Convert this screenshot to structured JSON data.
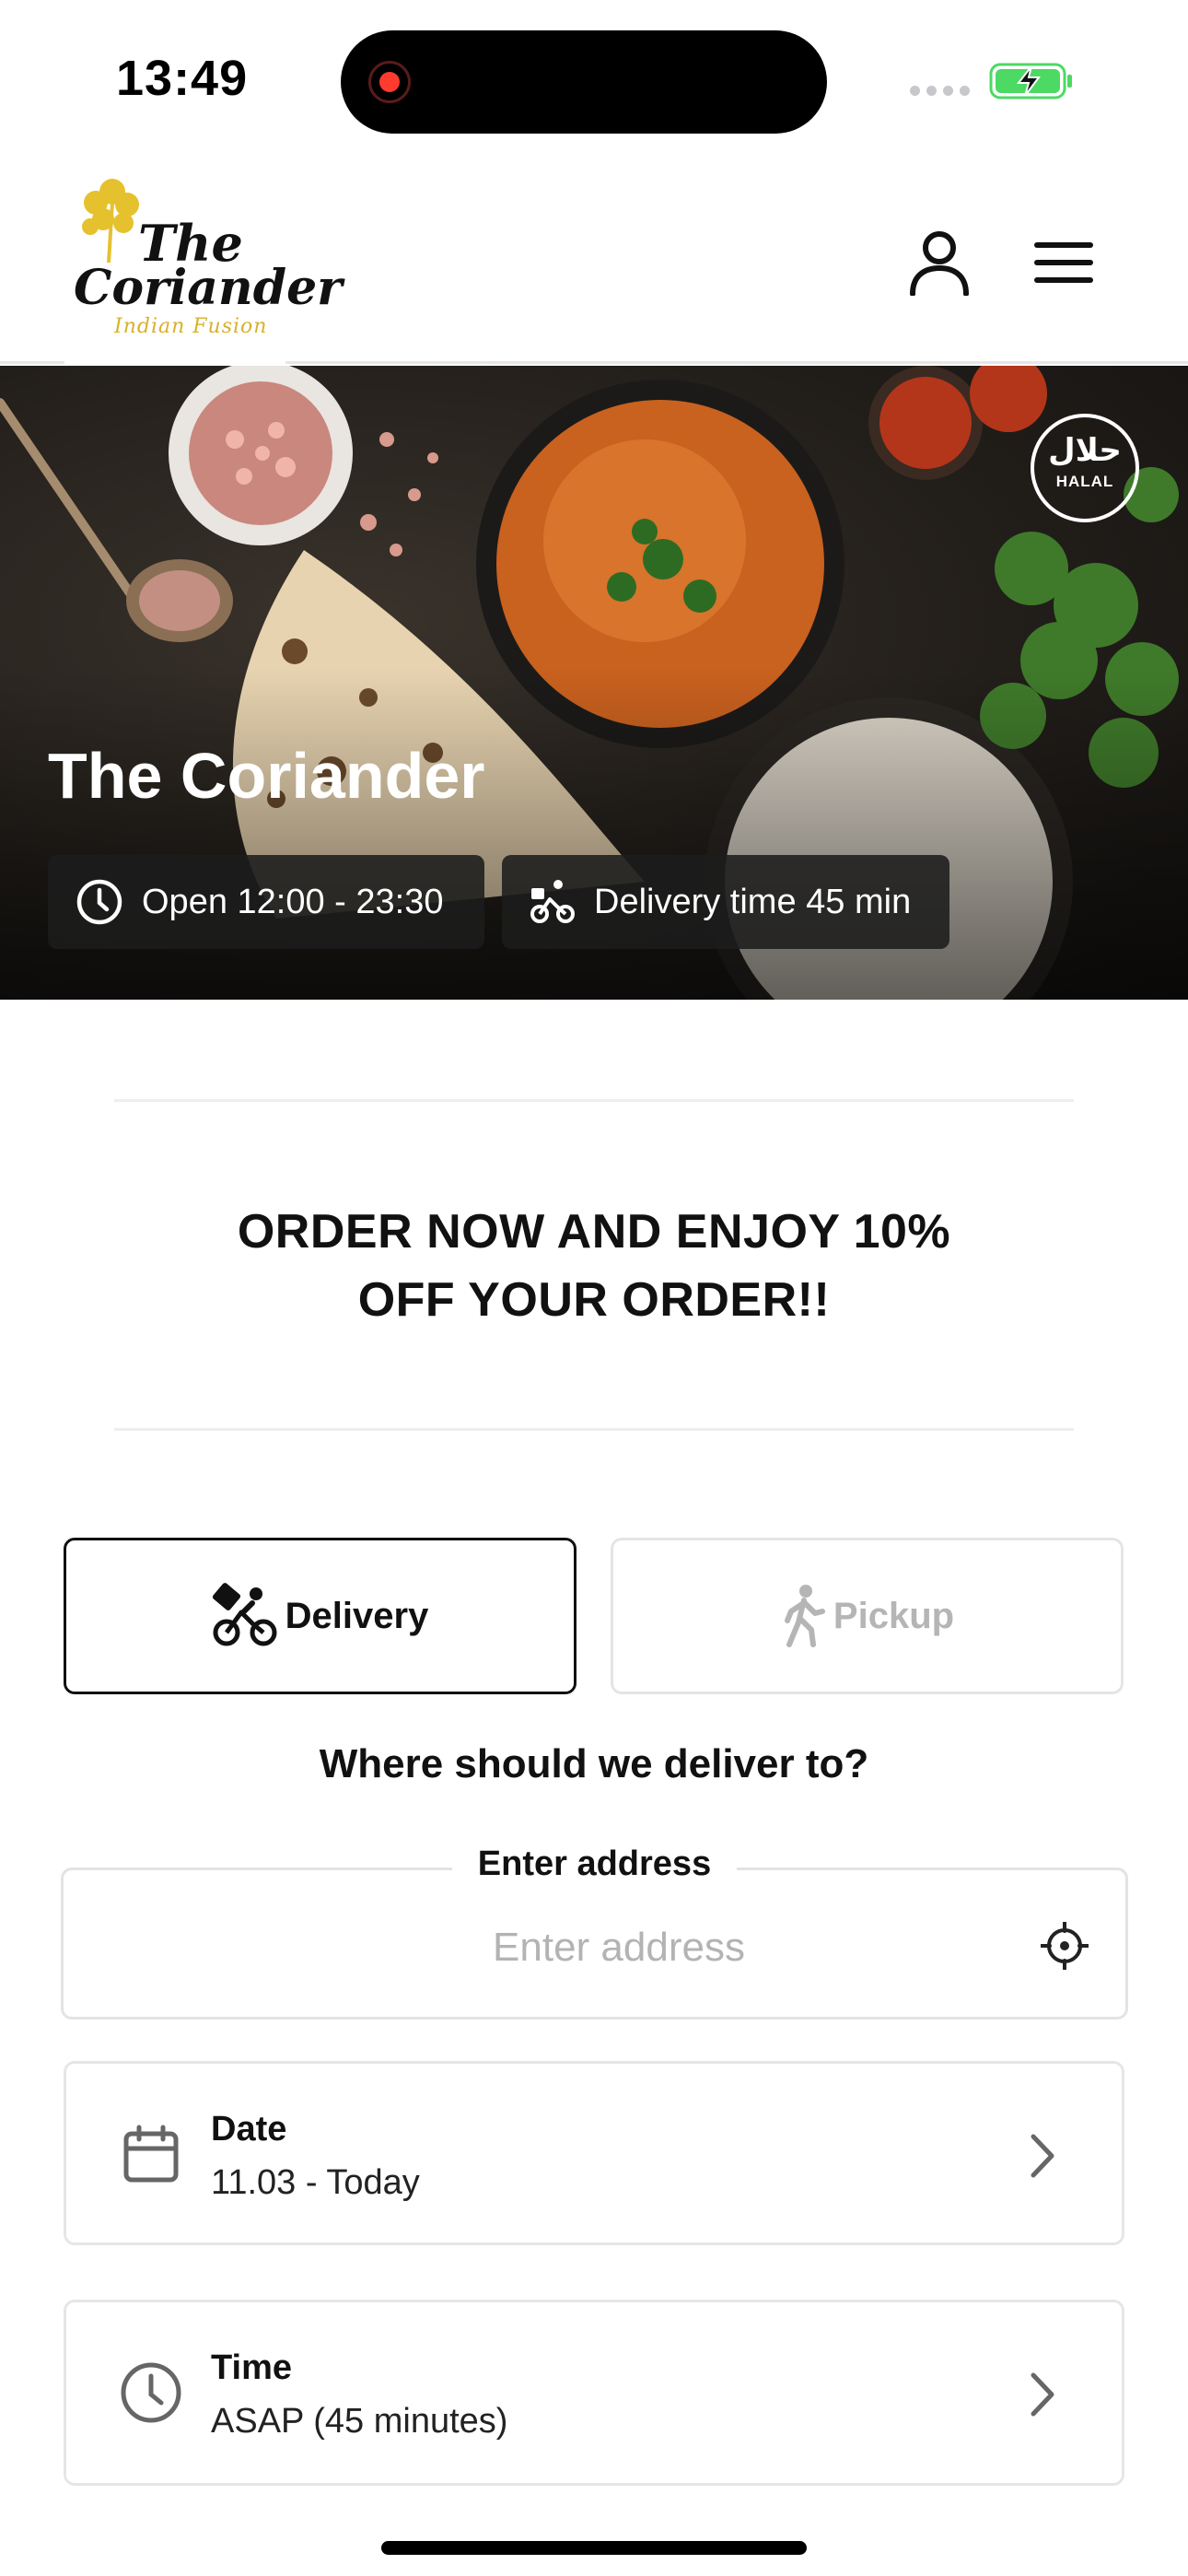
{
  "status_bar": {
    "time": "13:49"
  },
  "header": {
    "logo_line1": "The",
    "logo_line2": "Coriander",
    "logo_tagline": "Indian Fusion",
    "icons": [
      "user-icon",
      "hamburger-menu-icon"
    ]
  },
  "hero": {
    "restaurant_name": "The Coriander",
    "halal_arabic": "حلال",
    "halal_label": "HALAL",
    "hours_text": "Open 12:00 - 23:30",
    "delivery_time_text": "Delivery time 45 min"
  },
  "promo": {
    "line1": "ORDER NOW AND ENJOY 10%",
    "line2": "OFF YOUR ORDER!!"
  },
  "order_mode": {
    "delivery_label": "Delivery",
    "pickup_label": "Pickup",
    "selected": "Delivery"
  },
  "address": {
    "question": "Where should we deliver to?",
    "field_label": "Enter address",
    "placeholder": "Enter address",
    "value": ""
  },
  "date_row": {
    "label": "Date",
    "value": "11.03 - Today"
  },
  "time_row": {
    "label": "Time",
    "value": "ASAP (45 minutes)"
  },
  "colors": {
    "accent_yellow": "#E6C12E",
    "selected_border": "#111111",
    "unselected_text": "#B5B5B5",
    "battery_green": "#4CD964"
  }
}
